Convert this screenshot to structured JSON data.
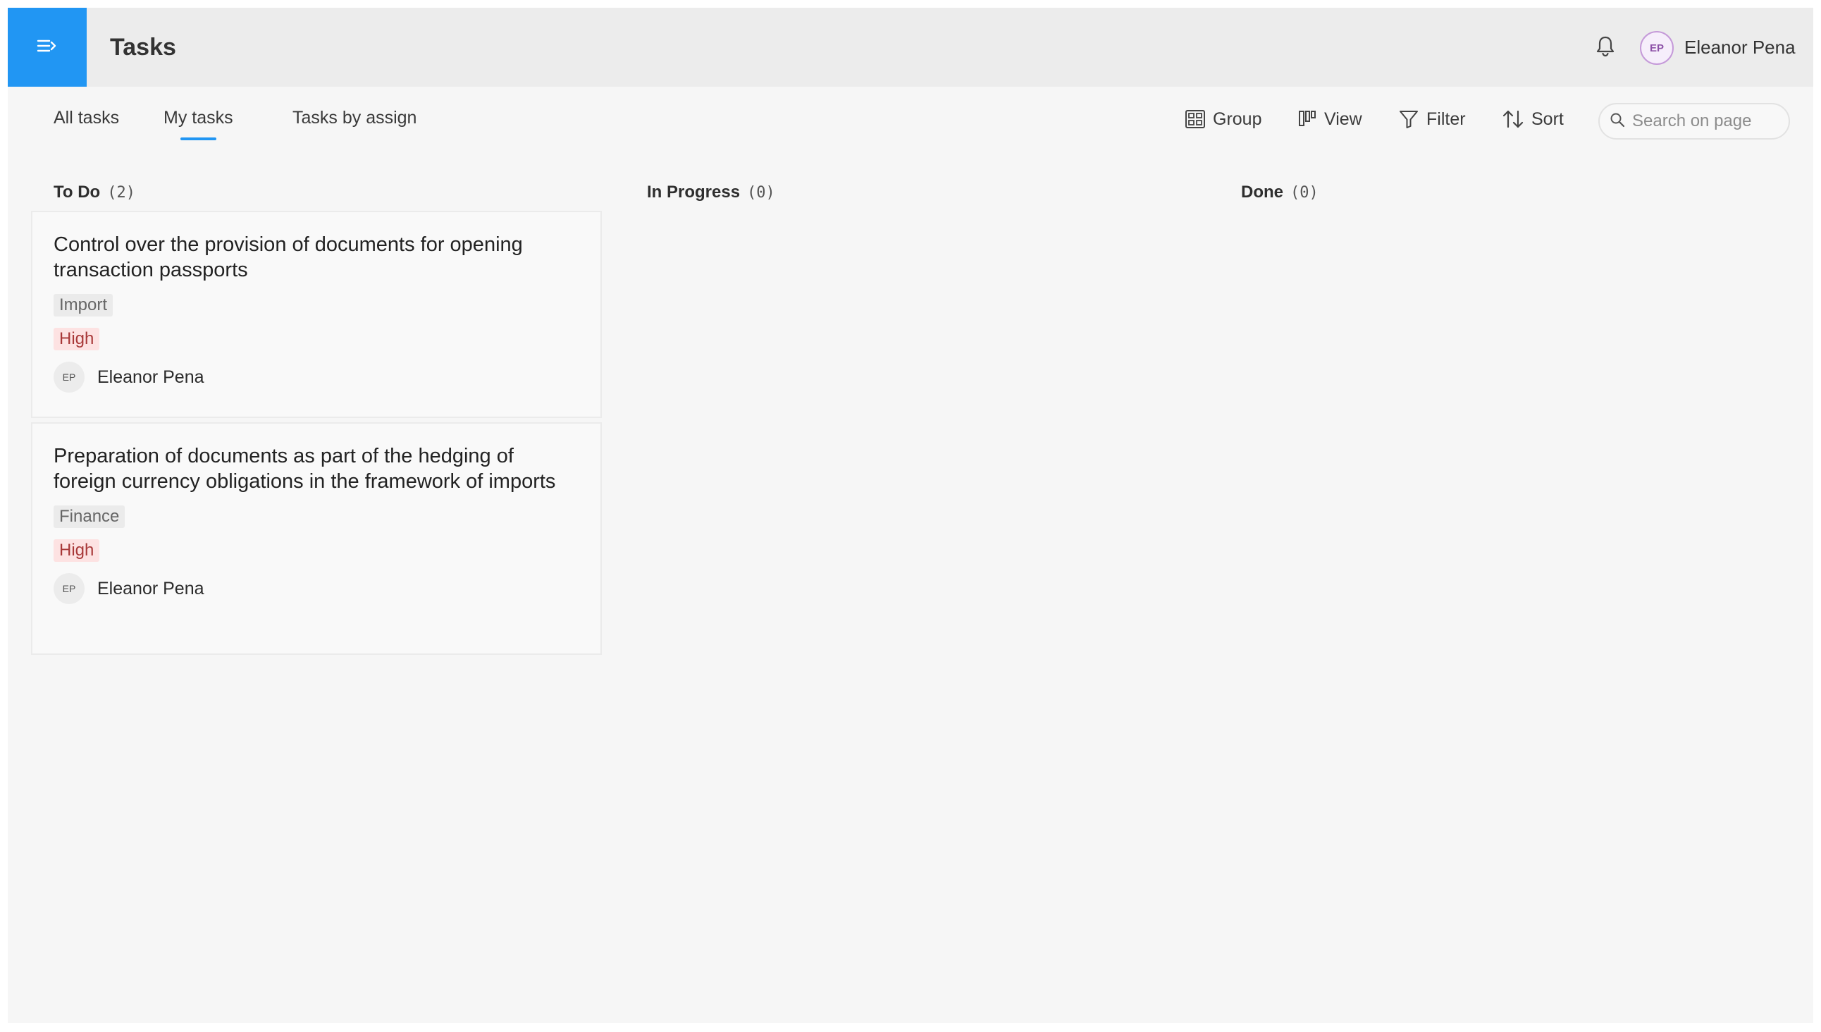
{
  "header": {
    "title": "Tasks",
    "user": {
      "initials": "EP",
      "name": "Eleanor Pena"
    }
  },
  "tabs": [
    {
      "label": "All tasks",
      "active": false
    },
    {
      "label": "My tasks",
      "active": true
    },
    {
      "label": "Tasks by assign",
      "active": false
    }
  ],
  "toolbar": {
    "group_label": "Group",
    "view_label": "View",
    "filter_label": "Filter",
    "sort_label": "Sort",
    "search_placeholder": "Search on page"
  },
  "columns": [
    {
      "name": "To Do",
      "count": "(2)",
      "cards": [
        {
          "title": "Control over the provision of documents for opening transaction passports",
          "category": "Import",
          "priority": "High",
          "assignee_initials": "EP",
          "assignee_name": "Eleanor Pena"
        },
        {
          "title": "Preparation of documents as part of the hedging of foreign currency obligations in the framework of imports",
          "category": "Finance",
          "priority": "High",
          "assignee_initials": "EP",
          "assignee_name": "Eleanor Pena"
        }
      ]
    },
    {
      "name": "In Progress",
      "count": "(0)",
      "cards": []
    },
    {
      "name": "Done",
      "count": "(0)",
      "cards": []
    }
  ],
  "colors": {
    "accent": "#2196f3",
    "priority_high_bg": "#fde2e2",
    "priority_high_text": "#a83838"
  }
}
